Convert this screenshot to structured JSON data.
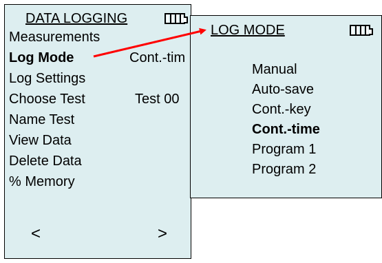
{
  "left_screen": {
    "title": "DATA LOGGING",
    "items": [
      {
        "label": "Measurements",
        "value": ""
      },
      {
        "label": "Log Mode",
        "value": "Cont.-tim"
      },
      {
        "label": "Log Settings",
        "value": ""
      },
      {
        "label": "Choose Test",
        "value": "Test 00"
      },
      {
        "label": "Name Test",
        "value": ""
      },
      {
        "label": "View Data",
        "value": ""
      },
      {
        "label": "Delete Data",
        "value": ""
      },
      {
        "label": "% Memory",
        "value": ""
      }
    ],
    "prev_label": "<",
    "next_label": ">"
  },
  "right_screen": {
    "title": "LOG MODE",
    "options": [
      "Manual",
      "Auto-save",
      "Cont.-key",
      "Cont.-time",
      "Program 1",
      "Program 2"
    ],
    "selected": "Cont.-time"
  },
  "colors": {
    "screen_background": "#ddeef0",
    "arrow": "#ff0000"
  },
  "icons": [
    "battery-icon",
    "arrow-icon"
  ]
}
